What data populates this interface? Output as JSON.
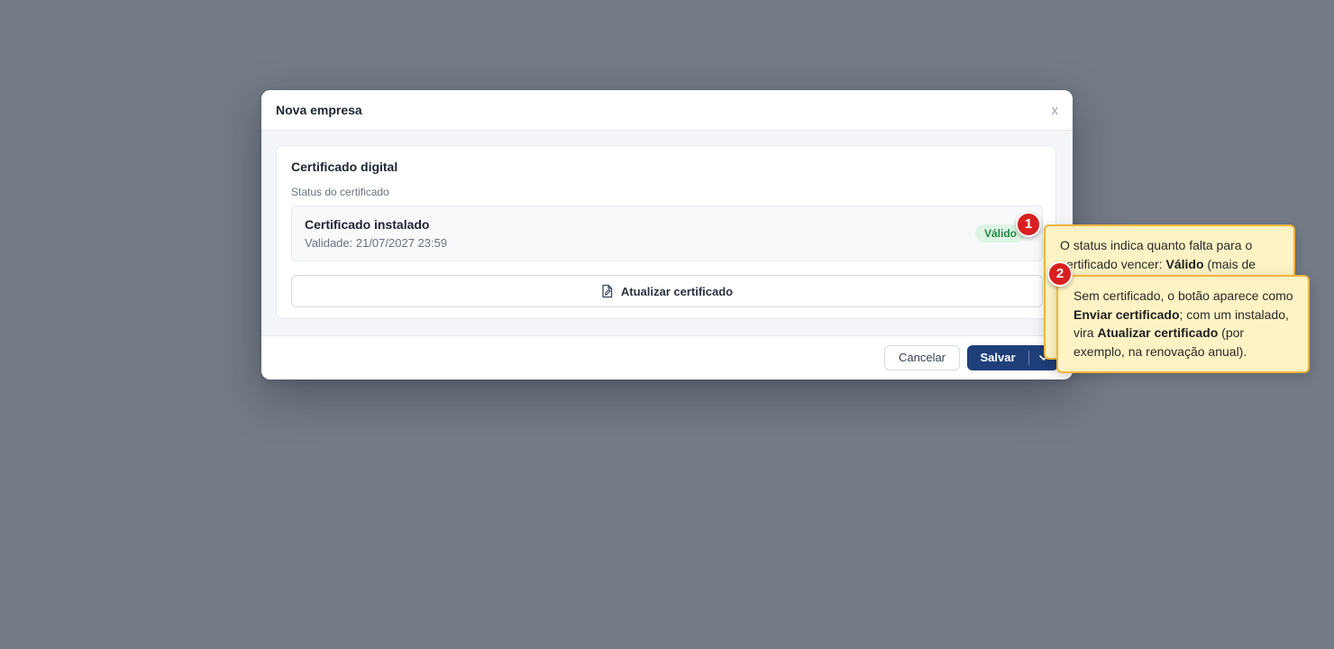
{
  "modal": {
    "title": "Nova empresa",
    "close_label": "x"
  },
  "certificate": {
    "section_title": "Certificado digital",
    "status_label": "Status do certificado",
    "status_name": "Certificado instalado",
    "validity": "Validade: 21/07/2027 23:59",
    "badge": "Válido",
    "update_button_label": "Atualizar certificado"
  },
  "footer": {
    "cancel_label": "Cancelar",
    "save_label": "Salvar"
  },
  "annotations": [
    {
      "number": "1",
      "text_before": "O status indica quanto falta para o certificado vencer: ",
      "bold": "Válido",
      "text_after": " (mais de"
    },
    {
      "number": "2",
      "line_1": "Sem certificado, o botão aparece como ",
      "bold_1": "Enviar certificado",
      "line_2": "; com um instalado, vira ",
      "bold_2": "Atualizar certificado",
      "line_3": " (por exemplo, na renovação anual)."
    }
  ],
  "colors": {
    "overlay": "#737b87",
    "primary": "#1f3f7a",
    "badge_bg": "#dcf5e3",
    "badge_text": "#1f8a45",
    "tip_bg": "#fef3c4",
    "tip_border": "#f0b43a",
    "marker": "#d81f1f"
  },
  "icons": [
    "document-edit-icon",
    "chevron-down-icon"
  ]
}
